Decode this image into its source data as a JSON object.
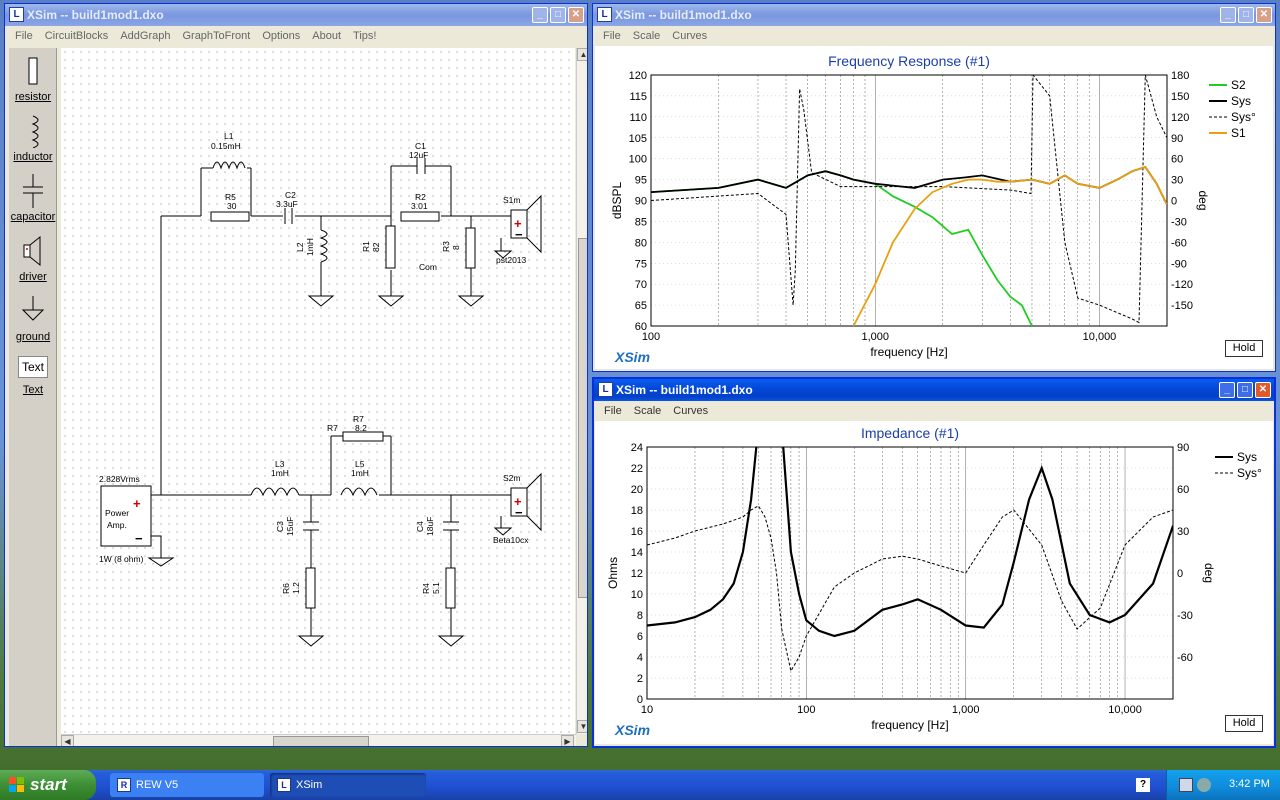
{
  "schematic_window": {
    "title": "XSim -- build1mod1.dxo",
    "menu": [
      "File",
      "CircuitBlocks",
      "AddGraph",
      "GraphToFront",
      "Options",
      "About",
      "Tips!"
    ],
    "tools": [
      "resistor",
      "inductor",
      "capacitor",
      "driver",
      "ground",
      "Text"
    ],
    "text_tool_icon": "Text",
    "components": {
      "L1": "L1",
      "L1_val": "0.15mH",
      "R5": "R5",
      "R5_val": "30",
      "C2": "C2",
      "C2_val": "3.3uF",
      "L2": "L2",
      "L2_val": "1mH",
      "C1": "C1",
      "C1_val": "12uF",
      "R2": "R2",
      "R2_val": "3.01",
      "R1": "R1",
      "R1_val": "82",
      "R3": "R3",
      "R3_val": "8",
      "com": "Com",
      "S1": "S1m",
      "S1_label": "pst2013",
      "R7": "R7",
      "R7_val": "8.2",
      "L3": "L3",
      "L3_val": "1mH",
      "L5": "L5",
      "L5_val": "1mH",
      "C3": "C3",
      "C3_val": "15uF",
      "R6": "R6",
      "R6_val": "1.2",
      "C4": "C4",
      "C4_val": "18uF",
      "R4": "R4",
      "R4_val": "5.1",
      "S2": "S2m",
      "S2_label": "Beta10cx",
      "amp_voltage": "2.828Vrms",
      "amp_label1": "Power",
      "amp_label2": "Amp.",
      "amp_power": "1W (8 ohm)"
    }
  },
  "freq_window": {
    "title": "XSim -- build1mod1.dxo",
    "menu": [
      "File",
      "Scale",
      "Curves"
    ],
    "hold": "Hold",
    "brand": "XSim"
  },
  "imp_window": {
    "title": "XSim -- build1mod1.dxo",
    "menu": [
      "File",
      "Scale",
      "Curves"
    ],
    "hold": "Hold",
    "brand": "XSim"
  },
  "chart_data": [
    {
      "type": "line",
      "title": "Frequency Response (#1)",
      "xlabel": "frequency [Hz]",
      "ylabel": "dBSPL",
      "y2label": "deg",
      "xscale": "log",
      "xlim": [
        100,
        20000
      ],
      "ylim": [
        60,
        120
      ],
      "y2lim": [
        -180,
        180
      ],
      "x_ticks": [
        "100",
        "1,000",
        "10,000"
      ],
      "y_ticks": [
        60,
        65,
        70,
        75,
        80,
        85,
        90,
        95,
        100,
        105,
        110,
        115,
        120
      ],
      "y2_ticks": [
        -150,
        -120,
        -90,
        -60,
        -30,
        0,
        30,
        60,
        90,
        120,
        150,
        180
      ],
      "grid": true,
      "legend": "right",
      "series": [
        {
          "name": "S2",
          "color": "#22cc22",
          "axis": "left",
          "x": [
            100,
            200,
            300,
            400,
            500,
            600,
            700,
            800,
            1000,
            1200,
            1500,
            1800,
            2200,
            2600,
            3000,
            3500,
            4000,
            4500,
            5000
          ],
          "y": [
            92,
            93,
            95,
            93,
            96,
            97,
            96,
            95,
            94,
            91,
            88.5,
            86,
            82,
            83,
            77,
            71,
            67,
            65,
            60
          ]
        },
        {
          "name": "Sys",
          "color": "#000000",
          "axis": "left",
          "x": [
            100,
            200,
            300,
            400,
            500,
            600,
            700,
            800,
            1000,
            1500,
            2000,
            2500,
            3000,
            4000,
            5000,
            6000,
            7000,
            8000,
            10000,
            12000,
            14000,
            16000,
            18000,
            20000
          ],
          "y": [
            92,
            93,
            95,
            93,
            96,
            97,
            96,
            95,
            94,
            93,
            95,
            95.5,
            96,
            94.5,
            95,
            94,
            96,
            94,
            93,
            95,
            97,
            98,
            94,
            89
          ]
        },
        {
          "name": "Sys°",
          "color": "#000000",
          "axis": "right",
          "dash": true,
          "x": [
            100,
            300,
            400,
            430,
            440,
            460,
            480,
            520,
            700,
            1000,
            2000,
            4000,
            4950,
            5050,
            6000,
            7000,
            8000,
            10000,
            14000,
            15000,
            16000,
            18000,
            20000
          ],
          "y": [
            0,
            10,
            -20,
            -150,
            -100,
            160,
            130,
            40,
            20,
            20,
            20,
            15,
            10,
            180,
            150,
            -60,
            -140,
            -150,
            -170,
            -175,
            180,
            120,
            90
          ]
        },
        {
          "name": "S1",
          "color": "#e8a010",
          "axis": "left",
          "x": [
            800,
            1000,
            1200,
            1500,
            1800,
            2200,
            2600,
            3000,
            3500,
            4000,
            5000,
            6000,
            7000,
            8000,
            10000,
            12000,
            14000,
            16000,
            18000,
            20000
          ],
          "y": [
            60,
            70,
            80,
            88,
            92,
            94,
            95,
            95,
            94.5,
            94.5,
            95,
            94,
            96,
            94,
            93,
            95,
            97,
            98,
            94,
            89
          ]
        }
      ]
    },
    {
      "type": "line",
      "title": "Impedance (#1)",
      "xlabel": "frequency [Hz]",
      "ylabel": "Ohms",
      "y2label": "deg",
      "xscale": "log",
      "xlim": [
        10,
        20000
      ],
      "ylim": [
        0,
        24
      ],
      "y2lim": [
        -90,
        90
      ],
      "x_ticks": [
        "10",
        "100",
        "1,000",
        "10,000"
      ],
      "y_ticks": [
        0,
        2,
        4,
        6,
        8,
        10,
        12,
        14,
        16,
        18,
        20,
        22,
        24
      ],
      "y2_ticks": [
        -60,
        -30,
        0,
        30,
        60,
        90
      ],
      "grid": true,
      "legend": "right",
      "series": [
        {
          "name": "Sys",
          "color": "#000000",
          "axis": "left",
          "bold": true,
          "x": [
            10,
            15,
            20,
            25,
            30,
            35,
            40,
            45,
            50,
            55,
            60,
            70,
            80,
            90,
            100,
            120,
            150,
            200,
            300,
            400,
            500,
            700,
            1000,
            1300,
            1700,
            2000,
            2500,
            3000,
            3500,
            4500,
            6000,
            8000,
            10000,
            15000,
            20000
          ],
          "y": [
            7,
            7.3,
            7.8,
            8.5,
            9.5,
            11,
            14,
            19,
            26,
            26,
            26,
            26,
            14,
            10,
            7.5,
            6.5,
            6,
            6.5,
            8.5,
            9,
            9.5,
            8.5,
            7,
            6.8,
            9,
            13,
            19,
            22,
            19,
            11,
            8,
            7.3,
            8,
            11,
            16.5
          ]
        },
        {
          "name": "Sys°",
          "color": "#000000",
          "axis": "right",
          "dash": true,
          "x": [
            10,
            15,
            20,
            30,
            40,
            45,
            50,
            55,
            60,
            65,
            70,
            80,
            90,
            100,
            150,
            200,
            300,
            400,
            500,
            700,
            1000,
            1300,
            1700,
            2000,
            3000,
            4000,
            5000,
            7000,
            10000,
            15000,
            20000
          ],
          "y": [
            20,
            25,
            30,
            35,
            40,
            45,
            48,
            40,
            25,
            0,
            -40,
            -70,
            -60,
            -45,
            -10,
            0,
            10,
            12,
            10,
            5,
            0,
            20,
            40,
            45,
            20,
            -20,
            -40,
            -25,
            20,
            40,
            45
          ]
        }
      ]
    }
  ],
  "taskbar": {
    "start": "start",
    "tasks": [
      "REW V5",
      "XSim"
    ],
    "clock": "3:42 PM"
  }
}
